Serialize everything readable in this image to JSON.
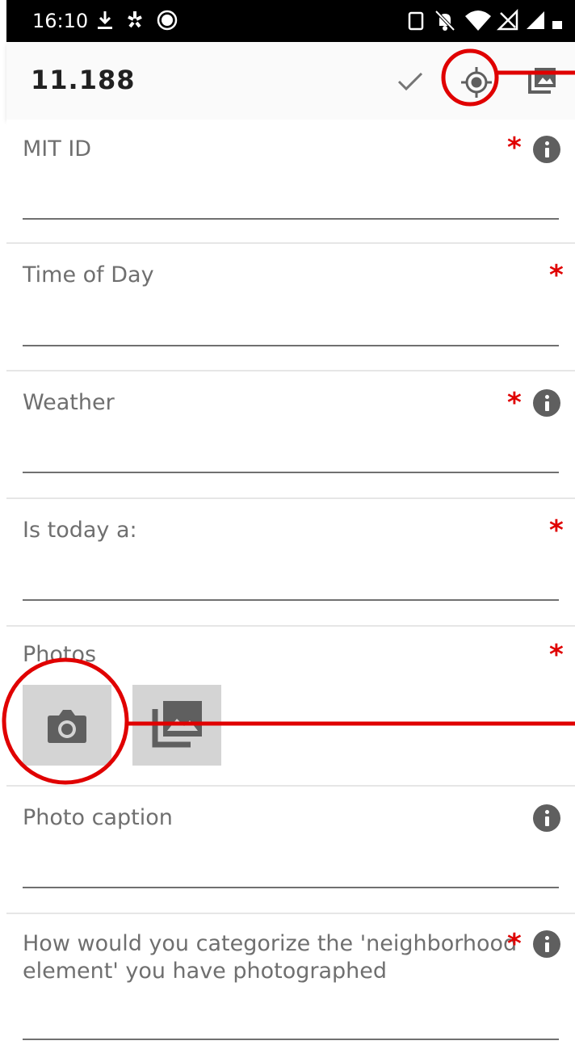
{
  "status_bar": {
    "time": "16:10",
    "icons_left": [
      "download-icon",
      "yelp-icon",
      "record-icon"
    ],
    "icons_right": [
      "vibrate-icon",
      "notifications-off-icon",
      "wifi-icon",
      "no-signal-icon",
      "signal-icon",
      "battery-icon"
    ]
  },
  "app_bar": {
    "title": "11.188",
    "actions": [
      "check-icon",
      "gps-location-icon",
      "gallery-icon"
    ]
  },
  "form": {
    "fields": [
      {
        "label": "MIT ID",
        "required": true,
        "info": true,
        "value": ""
      },
      {
        "label": "Time of Day",
        "required": true,
        "info": false,
        "value": ""
      },
      {
        "label": "Weather",
        "required": true,
        "info": true,
        "value": ""
      },
      {
        "label": "Is today a:",
        "required": true,
        "info": false,
        "value": ""
      },
      {
        "label": "Photos",
        "required": true,
        "info": false,
        "buttons": [
          "camera-icon",
          "gallery-icon"
        ]
      },
      {
        "label": "Photo caption",
        "required": false,
        "info": true,
        "value": ""
      },
      {
        "label": "How would you categorize the 'neighborhood element' you have photographed",
        "required": true,
        "info": true,
        "value": ""
      }
    ],
    "required_mark": "*"
  },
  "annotations": {
    "color": "#e00000",
    "marks": [
      "circle-around-gps-location-icon",
      "circle-around-camera-button"
    ]
  },
  "colors": {
    "status_bar": "#000000",
    "app_bar": "#fafafa",
    "label": "#6f6f6f",
    "required": "#e00000",
    "info_icon": "#5f5f5f",
    "photo_button_bg": "#d4d4d4"
  }
}
